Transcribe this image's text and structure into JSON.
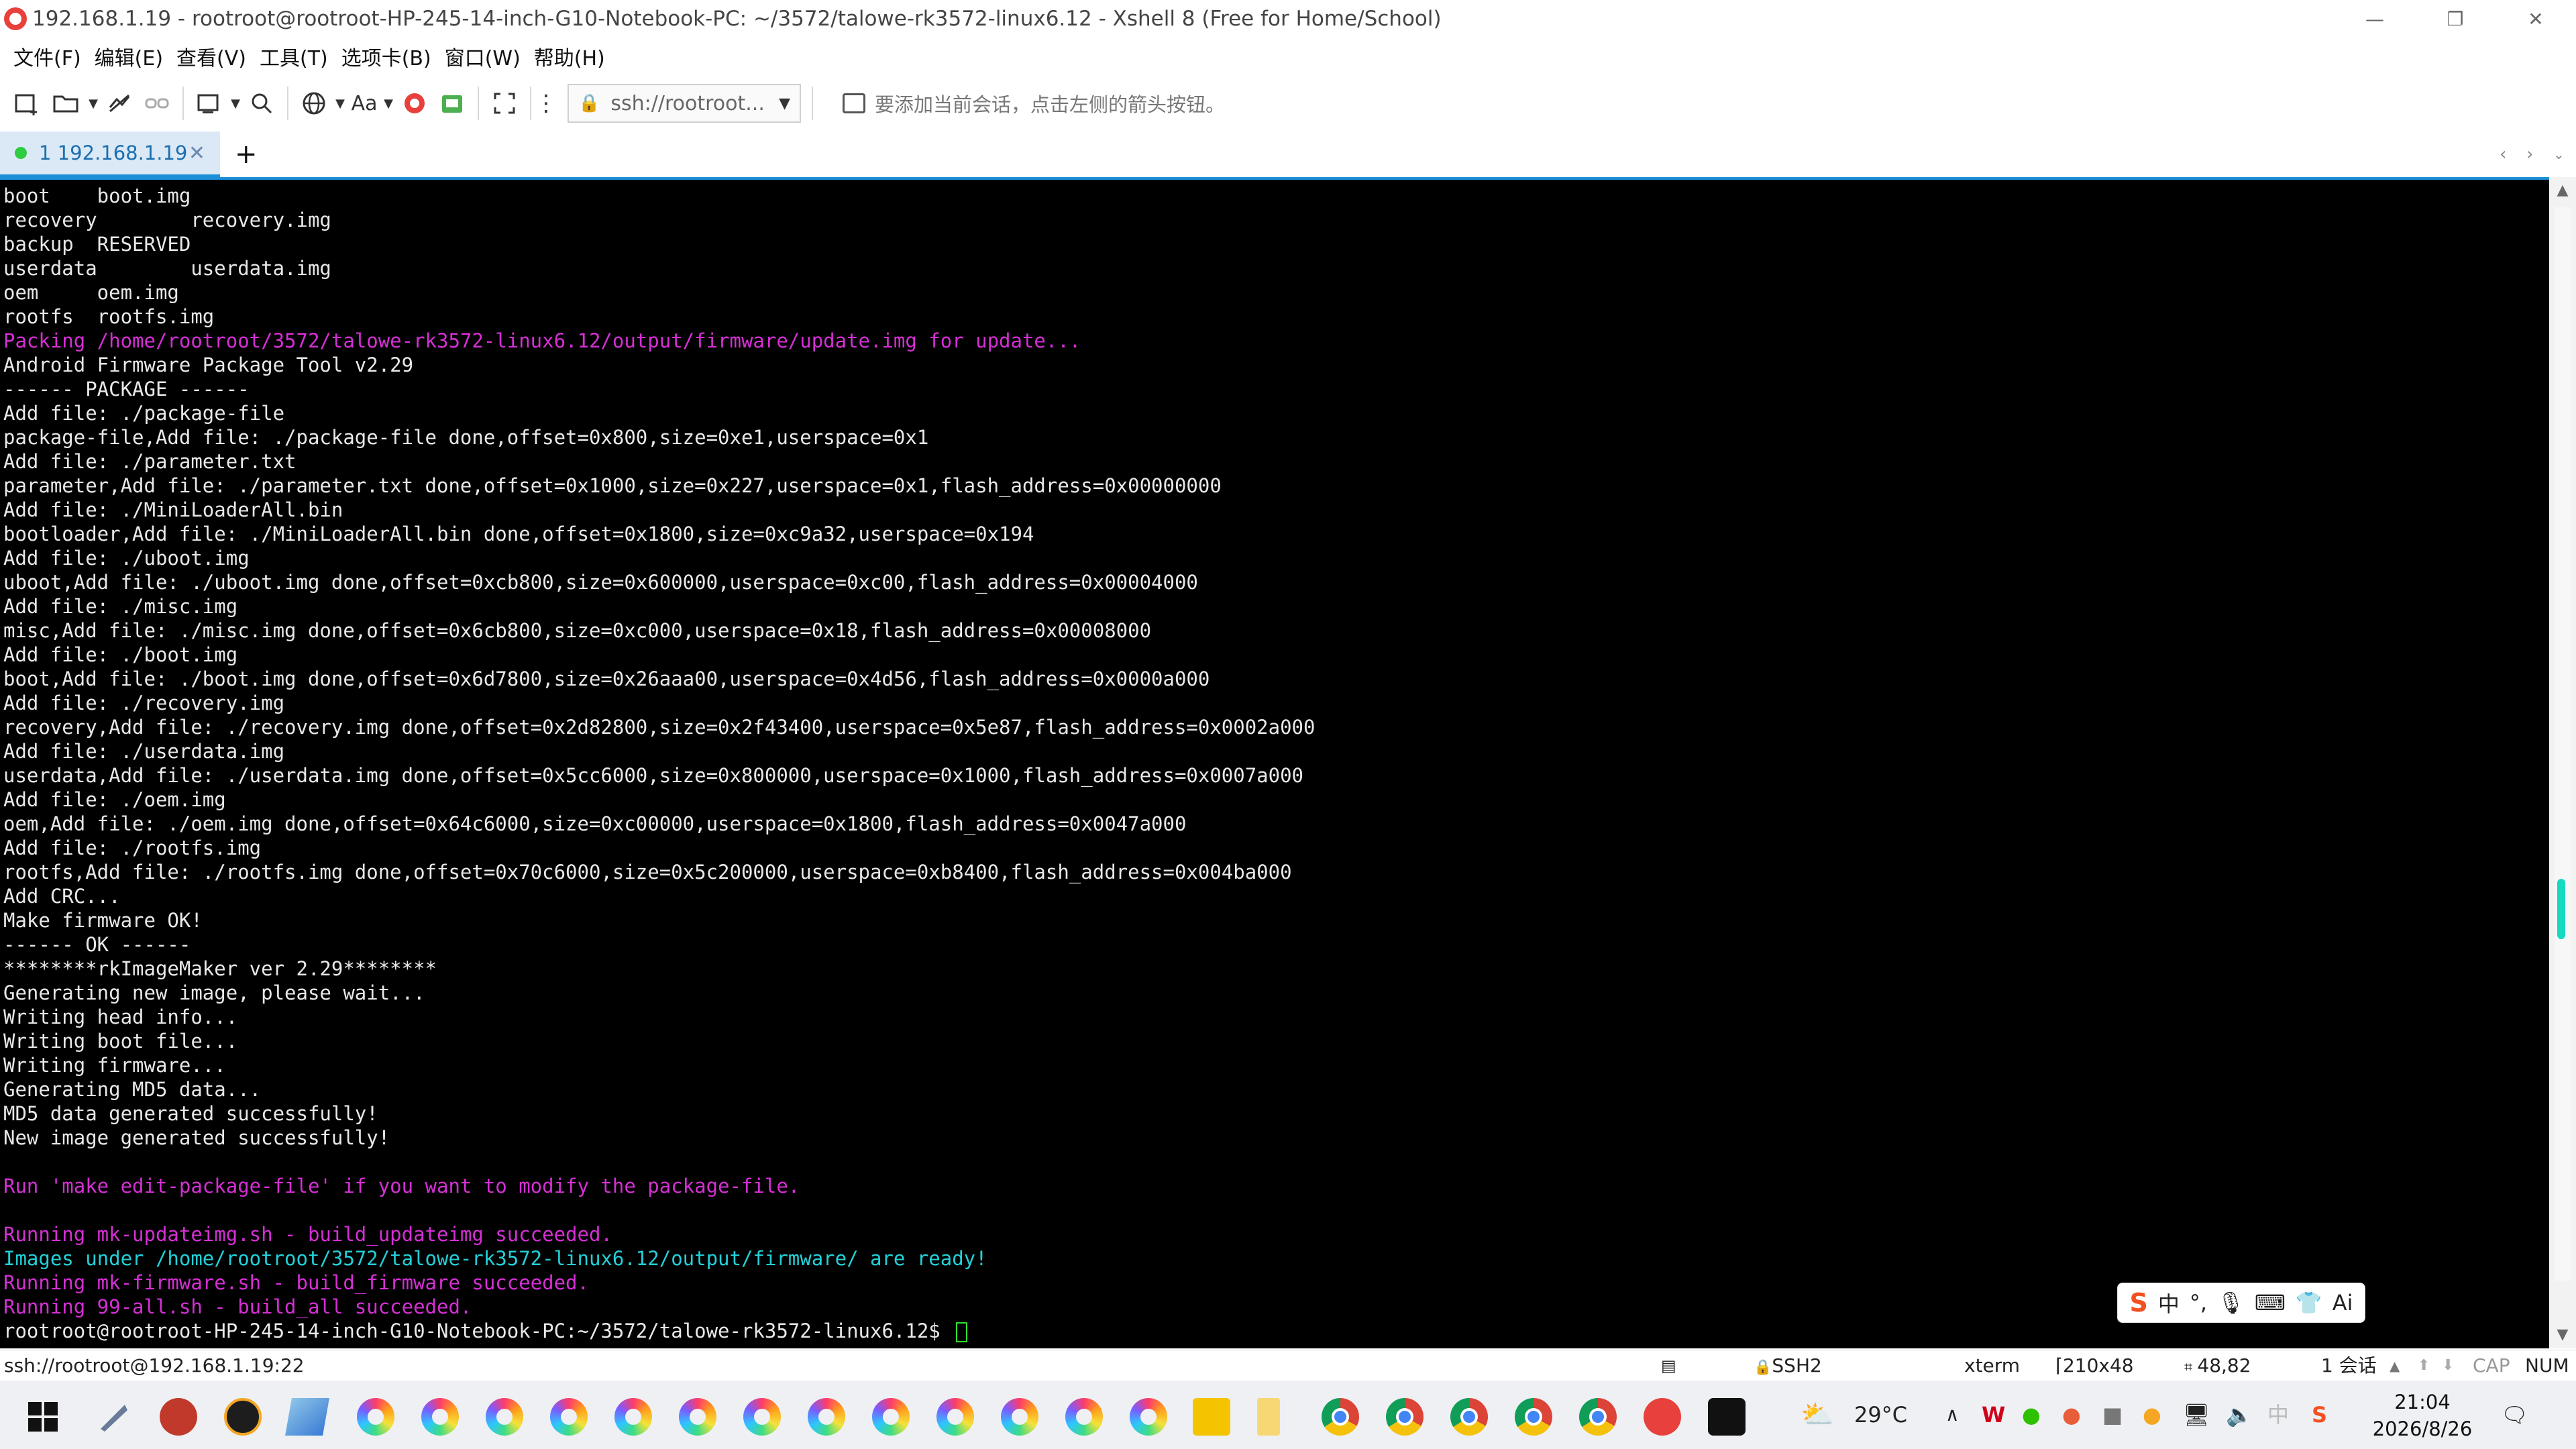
{
  "window": {
    "title": "192.168.1.19 - rootroot@rootroot-HP-245-14-inch-G10-Notebook-PC: ~/3572/talowe-rk3572-linux6.12 - Xshell 8 (Free for Home/School)",
    "minimize_glyph": "—",
    "restore_glyph": "❐",
    "close_glyph": "✕"
  },
  "menu": [
    "文件(F)",
    "编辑(E)",
    "查看(V)",
    "工具(T)",
    "选项卡(B)",
    "窗口(W)",
    "帮助(H)"
  ],
  "toolbar": {
    "font_label": "Aa",
    "address": "ssh://rootroot...",
    "hint": "要添加当前会话，点击左侧的箭头按钮。"
  },
  "tabs": [
    {
      "label": "1 192.168.1.19",
      "active": true,
      "status_color": "#2ecc40"
    }
  ],
  "tab_add_glyph": "+",
  "terminal": {
    "lines": [
      {
        "text": "boot    boot.img",
        "color": "white"
      },
      {
        "text": "recovery        recovery.img",
        "color": "white"
      },
      {
        "text": "backup  RESERVED",
        "color": "white"
      },
      {
        "text": "userdata        userdata.img",
        "color": "white"
      },
      {
        "text": "oem     oem.img",
        "color": "white"
      },
      {
        "text": "rootfs  rootfs.img",
        "color": "white"
      },
      {
        "text": "Packing /home/rootroot/3572/talowe-rk3572-linux6.12/output/firmware/update.img for update...",
        "color": "magenta"
      },
      {
        "text": "Android Firmware Package Tool v2.29",
        "color": "white"
      },
      {
        "text": "------ PACKAGE ------",
        "color": "white"
      },
      {
        "text": "Add file: ./package-file",
        "color": "white"
      },
      {
        "text": "package-file,Add file: ./package-file done,offset=0x800,size=0xe1,userspace=0x1",
        "color": "white"
      },
      {
        "text": "Add file: ./parameter.txt",
        "color": "white"
      },
      {
        "text": "parameter,Add file: ./parameter.txt done,offset=0x1000,size=0x227,userspace=0x1,flash_address=0x00000000",
        "color": "white"
      },
      {
        "text": "Add file: ./MiniLoaderAll.bin",
        "color": "white"
      },
      {
        "text": "bootloader,Add file: ./MiniLoaderAll.bin done,offset=0x1800,size=0xc9a32,userspace=0x194",
        "color": "white"
      },
      {
        "text": "Add file: ./uboot.img",
        "color": "white"
      },
      {
        "text": "uboot,Add file: ./uboot.img done,offset=0xcb800,size=0x600000,userspace=0xc00,flash_address=0x00004000",
        "color": "white"
      },
      {
        "text": "Add file: ./misc.img",
        "color": "white"
      },
      {
        "text": "misc,Add file: ./misc.img done,offset=0x6cb800,size=0xc000,userspace=0x18,flash_address=0x00008000",
        "color": "white"
      },
      {
        "text": "Add file: ./boot.img",
        "color": "white"
      },
      {
        "text": "boot,Add file: ./boot.img done,offset=0x6d7800,size=0x26aaa00,userspace=0x4d56,flash_address=0x0000a000",
        "color": "white"
      },
      {
        "text": "Add file: ./recovery.img",
        "color": "white"
      },
      {
        "text": "recovery,Add file: ./recovery.img done,offset=0x2d82800,size=0x2f43400,userspace=0x5e87,flash_address=0x0002a000",
        "color": "white"
      },
      {
        "text": "Add file: ./userdata.img",
        "color": "white"
      },
      {
        "text": "userdata,Add file: ./userdata.img done,offset=0x5cc6000,size=0x800000,userspace=0x1000,flash_address=0x0007a000",
        "color": "white"
      },
      {
        "text": "Add file: ./oem.img",
        "color": "white"
      },
      {
        "text": "oem,Add file: ./oem.img done,offset=0x64c6000,size=0xc00000,userspace=0x1800,flash_address=0x0047a000",
        "color": "white"
      },
      {
        "text": "Add file: ./rootfs.img",
        "color": "white"
      },
      {
        "text": "rootfs,Add file: ./rootfs.img done,offset=0x70c6000,size=0x5c200000,userspace=0xb8400,flash_address=0x004ba000",
        "color": "white"
      },
      {
        "text": "Add CRC...",
        "color": "white"
      },
      {
        "text": "Make firmware OK!",
        "color": "white"
      },
      {
        "text": "------ OK ------",
        "color": "white"
      },
      {
        "text": "********rkImageMaker ver 2.29********",
        "color": "white"
      },
      {
        "text": "Generating new image, please wait...",
        "color": "white"
      },
      {
        "text": "Writing head info...",
        "color": "white"
      },
      {
        "text": "Writing boot file...",
        "color": "white"
      },
      {
        "text": "Writing firmware...",
        "color": "white"
      },
      {
        "text": "Generating MD5 data...",
        "color": "white"
      },
      {
        "text": "MD5 data generated successfully!",
        "color": "white"
      },
      {
        "text": "New image generated successfully!",
        "color": "white"
      },
      {
        "text": "",
        "color": "white"
      },
      {
        "text": "Run 'make edit-package-file' if you want to modify the package-file.",
        "color": "magenta"
      },
      {
        "text": "",
        "color": "white"
      },
      {
        "text": "Running mk-updateimg.sh - build_updateimg succeeded.",
        "color": "magenta"
      },
      {
        "text": "Images under /home/rootroot/3572/talowe-rk3572-linux6.12/output/firmware/ are ready!",
        "color": "cyan"
      },
      {
        "text": "Running mk-firmware.sh - build_firmware succeeded.",
        "color": "magenta"
      },
      {
        "text": "Running 99-all.sh - build_all succeeded.",
        "color": "magenta"
      }
    ],
    "prompt": "rootroot@rootroot-HP-245-14-inch-G10-Notebook-PC:~/3572/talowe-rk3572-linux6.12$ ",
    "colors": {
      "white": "#e8e8e8",
      "magenta": "#d62fd6",
      "cyan": "#23d0d8",
      "cursor": "#2ee02e"
    }
  },
  "ime": {
    "logo": "S",
    "lang": "中",
    "punct": "°,",
    "mic": "🎙",
    "keyboard": "⌨",
    "skin": "👕",
    "ai": "Ai"
  },
  "statusbar": {
    "session": "ssh://rootroot@192.168.1.19:22",
    "protocol": "SSH2",
    "term": "xterm",
    "size": "210x48",
    "position": "48,82",
    "sessions": "1 会话",
    "cap": "CAP",
    "num": "NUM"
  },
  "taskbar": {
    "weather": "29°C",
    "tray_lang": "中",
    "time": "21:04",
    "date": "2026/8/26"
  }
}
